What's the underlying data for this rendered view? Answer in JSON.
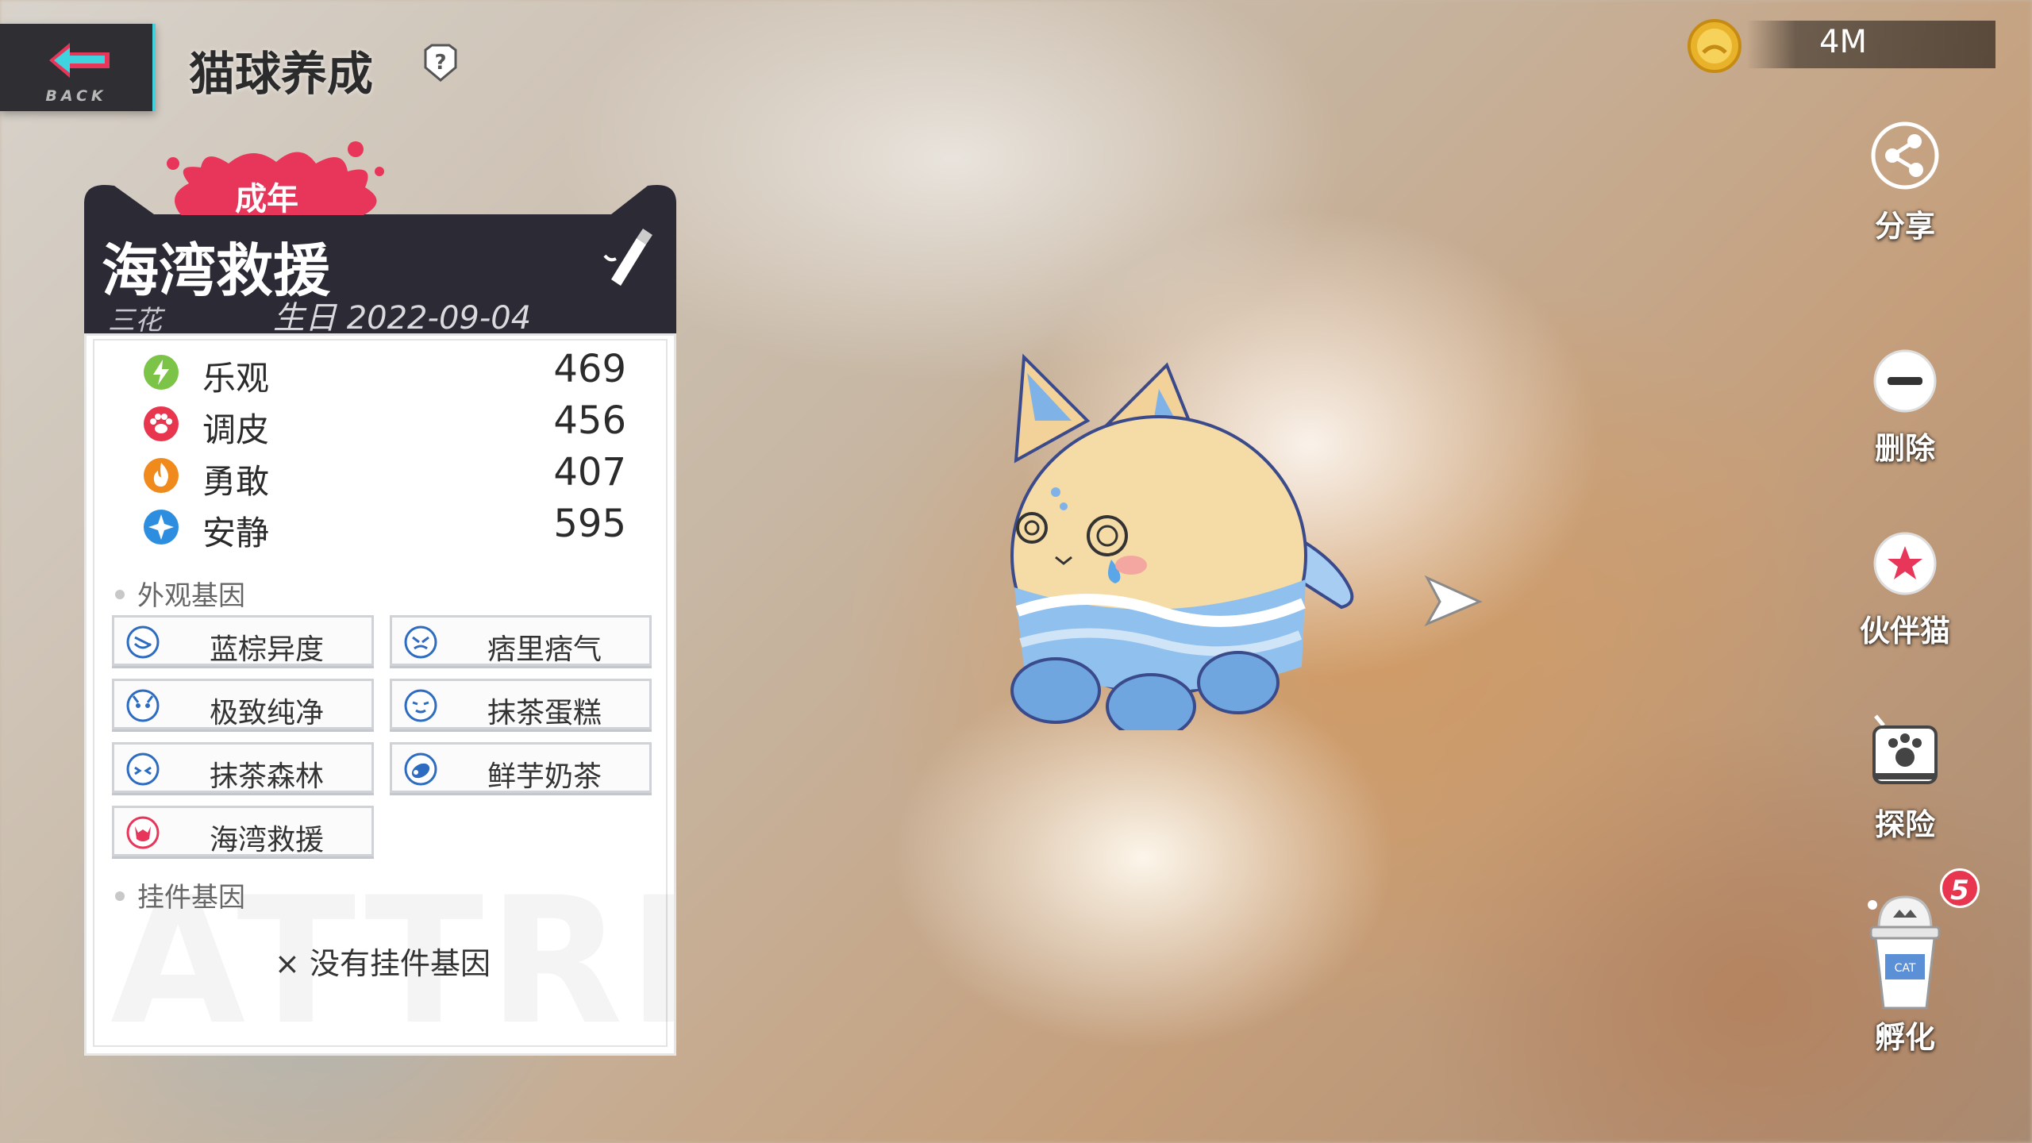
{
  "header": {
    "back_label": "BACK",
    "title": "猫球养成"
  },
  "currency": {
    "value": "4M",
    "icon": "coin-icon"
  },
  "side_menu": [
    {
      "label": "分享",
      "icon": "share-icon"
    },
    {
      "label": "删除",
      "icon": "minus-circle-icon"
    },
    {
      "label": "伙伴猫",
      "icon": "star-icon"
    },
    {
      "label": "探险",
      "icon": "paw-camera-icon"
    },
    {
      "label": "孵化",
      "icon": "incubator-cup-icon"
    }
  ],
  "hatch_badge": "5",
  "cat": {
    "stage": "成年",
    "name": "海湾救援",
    "breed": "三花",
    "birthday": "生日 2022-09-04"
  },
  "stats": [
    {
      "name": "乐观",
      "value": "469",
      "icon": "lightning-icon",
      "color": "#7cc447"
    },
    {
      "name": "调皮",
      "value": "456",
      "icon": "paw-icon",
      "color": "#e8364f"
    },
    {
      "name": "勇敢",
      "value": "407",
      "icon": "flame-icon",
      "color": "#f08a1c"
    },
    {
      "name": "安静",
      "value": "595",
      "icon": "sparkle-icon",
      "color": "#2d8ee0"
    }
  ],
  "appearance_genes": {
    "title": "外观基因",
    "items": [
      {
        "label": "蓝棕异度",
        "icon": "blue-face-icon"
      },
      {
        "label": "痞里痞气",
        "icon": "blue-face-icon"
      },
      {
        "label": "极致纯净",
        "icon": "blue-face-icon"
      },
      {
        "label": "抹茶蛋糕",
        "icon": "blue-face-icon"
      },
      {
        "label": "抹茶森林",
        "icon": "blue-face-icon"
      },
      {
        "label": "鲜芋奶茶",
        "icon": "blue-pattern-icon"
      },
      {
        "label": "海湾救援",
        "icon": "red-face-icon"
      }
    ]
  },
  "accessory_genes": {
    "title": "挂件基因",
    "empty_text": "× 没有挂件基因"
  },
  "watermark": "ATTRIBU",
  "colors": {
    "accent_cyan": "#3fd3e0",
    "splash_pink": "#e8365a",
    "panel_dark": "#2b2a35"
  }
}
